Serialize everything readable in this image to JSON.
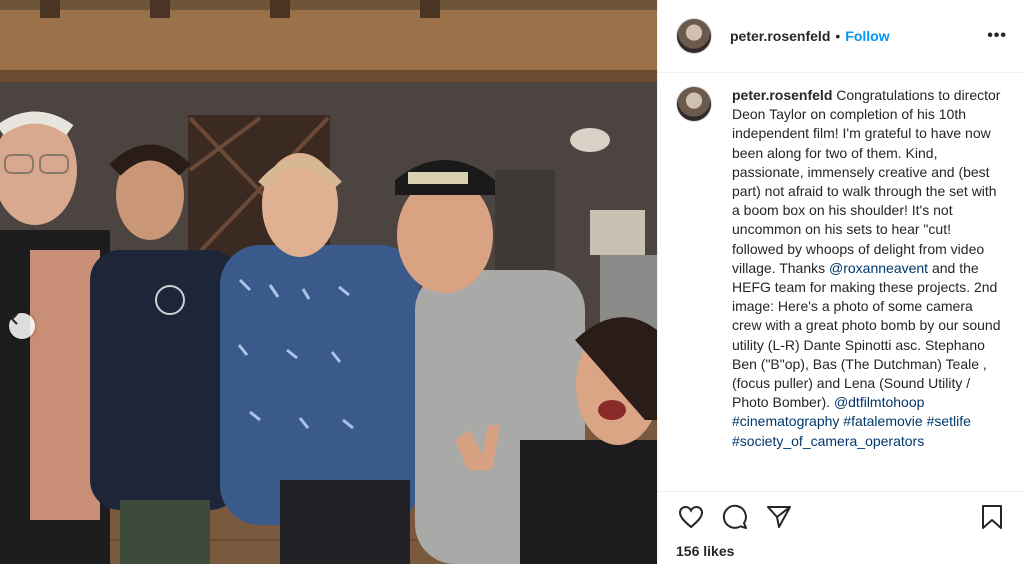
{
  "post": {
    "username": "peter.rosenfeld",
    "follow_label": "Follow",
    "dot": "•",
    "more": "•••",
    "caption": {
      "username": "peter.rosenfeld",
      "text_1": "Congratulations to director Deon Taylor on completion of his 10th independent film! I'm grateful to have now been along for two of them. Kind, passionate, immensely creative and (best part) not afraid to walk through the set with a boom box on his shoulder! It's not uncommon on his sets to hear \"cut! followed by whoops of delight from video village. Thanks ",
      "mention_1": "@roxanneavent",
      "text_2": " and the HEFG team for making these projects. 2nd image: Here's a photo of some camera crew with a great photo bomb by our sound utility (L-R) Dante Spinotti asc. Stephano Ben (\"B\"op), Bas (The Dutchman) Teale , (focus puller) and Lena (Sound Utility / Photo Bomber). ",
      "mention_2": "@dtfilmtohoop",
      "tag_1": "#cinematography",
      "tag_2": "#fatalemovie",
      "tag_3": "#setlife",
      "tag_4": "#society_of_camera_operators"
    },
    "likes": "156 likes"
  },
  "icons": {
    "like": "heart-icon",
    "comment": "comment-icon",
    "share": "share-icon",
    "save": "bookmark-icon",
    "prev": "chevron-left-icon"
  },
  "colors": {
    "link_blue": "#0095f6",
    "mention": "#00376b",
    "text": "#262626",
    "border": "#efefef"
  }
}
